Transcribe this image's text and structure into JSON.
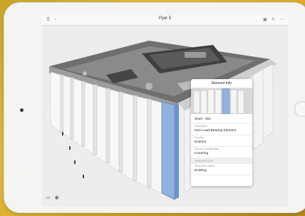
{
  "app": {
    "title": "Pyer 5"
  },
  "toolbar": {
    "left_icons": [
      "menu-icon",
      "back-icon"
    ],
    "right_icons": [
      "layers-icon",
      "markup-icon",
      "more-icon"
    ]
  },
  "element_info": {
    "title": "Element Info",
    "name": "Shell - 001",
    "fields": [
      {
        "label": "Description",
        "value": "Non-Load-Bearing Element"
      },
      {
        "label": "Function",
        "value": "Exterior"
      },
      {
        "label": "Element Classification",
        "value": "Covering"
      }
    ],
    "section_label": "GENERATION",
    "generation": {
      "label": "Generation Status",
      "value": "Existing"
    }
  },
  "bottom": {
    "icons": [
      "view-icon",
      "eye-icon"
    ]
  },
  "colors": {
    "background": "#d9a927",
    "highlight": "#8fb3de"
  }
}
